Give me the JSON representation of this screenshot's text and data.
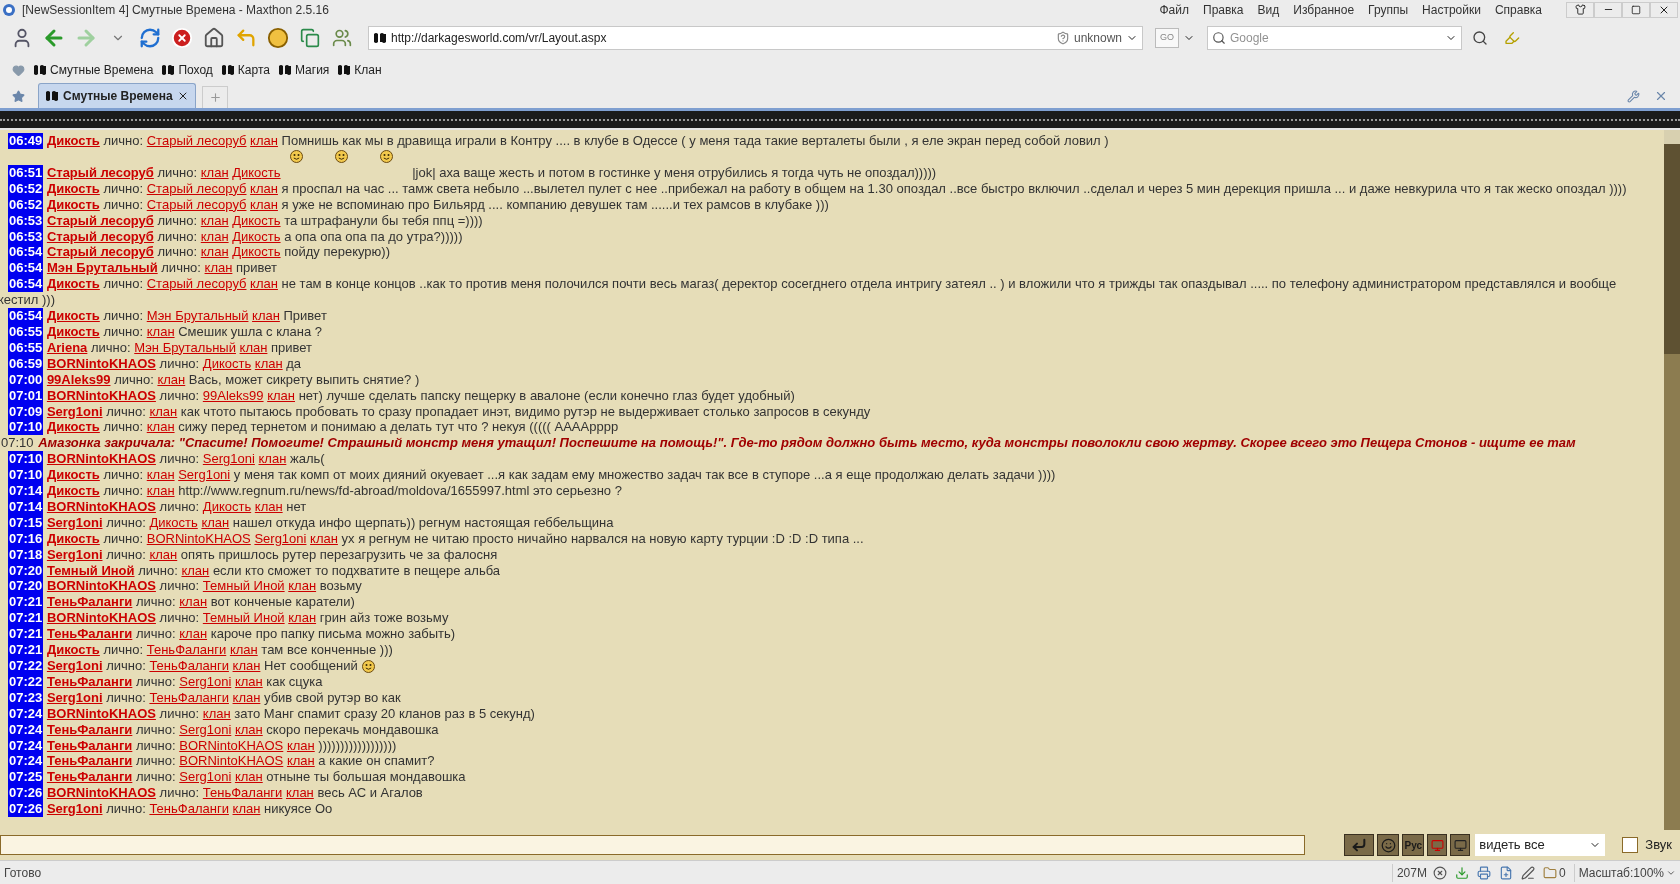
{
  "window": {
    "title": "[NewSessionItem 4] Смутные Времена - Maxthon 2.5.16"
  },
  "menu": [
    "Файл",
    "Правка",
    "Вид",
    "Избранное",
    "Группы",
    "Настройки",
    "Справка"
  ],
  "address": {
    "value": "http://darkagesworld.com/vr/Layout.aspx",
    "security": "unknown",
    "go": "GO"
  },
  "search": {
    "placeholder": "Google"
  },
  "bookmarks": [
    "Смутные Времена",
    "Поход",
    "Карта",
    "Магия",
    "Клан"
  ],
  "tabs": [
    {
      "label": "Смутные Времена",
      "selected": true
    }
  ],
  "messages": [
    {
      "kind": "private",
      "time": "06:49",
      "sender": "Дикость",
      "label": "лично:",
      "to": [
        "Старый лесоруб",
        "клан"
      ],
      "text": "Помнишь как мы в дравища играли в Контру .... в клубе в Одессе ( у меня тада такие верталеты были , я еле экран перед собой ловил )"
    },
    {
      "kind": "emotes"
    },
    {
      "kind": "private",
      "time": "06:51",
      "sender": "Старый лесоруб",
      "label": "лично:",
      "to": [
        "клан",
        "Дикость"
      ],
      "text": "|jok| аха ваще жесть и потом в гостинке у меня отрубились я тогда чуть не опоздал)))))",
      "indent": true
    },
    {
      "kind": "private",
      "time": "06:52",
      "sender": "Дикость",
      "label": "лично:",
      "to": [
        "Старый лесоруб",
        "клан"
      ],
      "text": "я проспал на час ... тамж света небыло ...вылетел пулет с нее ..прибежал на работу в общем на 1.30 опоздал ..все быстро включил ..сделал и через 5 мин дерекция пришла ... и даже невкурила что я так жеско опоздал ))))"
    },
    {
      "kind": "private",
      "time": "06:52",
      "sender": "Дикость",
      "label": "лично:",
      "to": [
        "Старый лесоруб",
        "клан"
      ],
      "text": "я уже не вспоминаю про Бильярд .... компанию девушек там ......и тех рамсов в клубаке )))"
    },
    {
      "kind": "private",
      "time": "06:53",
      "sender": "Старый лесоруб",
      "label": "лично:",
      "to": [
        "клан",
        "Дикость"
      ],
      "text": "та штрафанули бы тебя ппц =))))"
    },
    {
      "kind": "private",
      "time": "06:53",
      "sender": "Старый лесоруб",
      "label": "лично:",
      "to": [
        "клан",
        "Дикость"
      ],
      "text": "а опа опа опа па до утра?)))))"
    },
    {
      "kind": "private",
      "time": "06:54",
      "sender": "Старый лесоруб",
      "label": "лично:",
      "to": [
        "клан",
        "Дикость"
      ],
      "text": "пойду перекурю))"
    },
    {
      "kind": "private",
      "time": "06:54",
      "sender": "Мэн Брутальный",
      "label": "лично:",
      "to": [
        "клан"
      ],
      "text": "привет"
    },
    {
      "kind": "private",
      "time": "06:54",
      "sender": "Дикость",
      "label": "лично:",
      "to": [
        "Старый лесоруб",
        "клан"
      ],
      "text": "не там в конце концов ..как то против меня полочился почти весь магаз( деректор сосегднего отдела интригу затеял .. ) и вложили что я трижды так опаздывал ..... по телефону администратором представлялся и вообще",
      "wrap": "кестил )))"
    },
    {
      "kind": "private",
      "time": "06:54",
      "sender": "Дикость",
      "label": "лично:",
      "to": [
        "Мэн Брутальный",
        "клан"
      ],
      "text": "Привет"
    },
    {
      "kind": "private",
      "time": "06:55",
      "sender": "Дикость",
      "label": "лично:",
      "to": [
        "клан"
      ],
      "text": "Смешик ушла с клана ?"
    },
    {
      "kind": "private",
      "time": "06:55",
      "sender": "Ariena",
      "label": "лично:",
      "to": [
        "Мэн Брутальный",
        "клан"
      ],
      "text": "привет"
    },
    {
      "kind": "private",
      "time": "06:59",
      "sender": "BORNintoKHAOS",
      "label": "лично:",
      "to": [
        "Дикость",
        "клан"
      ],
      "text": "да"
    },
    {
      "kind": "private",
      "time": "07:00",
      "sender": "99Aleks99",
      "label": "лично:",
      "to": [
        "клан"
      ],
      "text": "Вась, может сикрету выпить снятие? )"
    },
    {
      "kind": "private",
      "time": "07:01",
      "sender": "BORNintoKHAOS",
      "label": "лично:",
      "to": [
        "99Aleks99",
        "клан"
      ],
      "text": "нет) лучше сделать папску пещерку в авалоне (если конечно глаз будет удобный)"
    },
    {
      "kind": "private",
      "time": "07:09",
      "sender": "Serg1oni",
      "label": "лично:",
      "to": [
        "клан"
      ],
      "text": "как чтото пытаюсь пробовать то сразу пропадает инэт, видимо рутэр не выдерживает столько запросов в секунду"
    },
    {
      "kind": "private",
      "time": "07:10",
      "sender": "Дикость",
      "label": "лично:",
      "to": [
        "клан"
      ],
      "text": "сижу перед тернетом и понимаю а делать тут что ? некуя ((((( ААААрррр"
    },
    {
      "kind": "system",
      "time": "07:10",
      "text": "Амазонка закричала: \"Спасите! Помогите! Страшный монстр меня утащил! Поспешите на помощь!\". Где-то рядом должно быть место, куда монстры поволокли свою жертву. Скорее всего это Пещера Стонов - ищите ее там"
    },
    {
      "kind": "private",
      "time": "07:10",
      "sender": "BORNintoKHAOS",
      "label": "лично:",
      "to": [
        "Serg1oni",
        "клан"
      ],
      "text": "жаль("
    },
    {
      "kind": "private",
      "time": "07:10",
      "sender": "Дикость",
      "label": "лично:",
      "to": [
        "клан",
        "Serg1oni"
      ],
      "text": "у меня так комп от моих дияний окуевает ...я как задам ему множество задач так все в ступоре ...а я еще продолжаю делать задачи ))))"
    },
    {
      "kind": "private",
      "time": "07:14",
      "sender": "Дикость",
      "label": "лично:",
      "to": [
        "клан"
      ],
      "text": "http://www.regnum.ru/news/fd-abroad/moldova/1655997.html это серьезно ?"
    },
    {
      "kind": "private",
      "time": "07:14",
      "sender": "BORNintoKHAOS",
      "label": "лично:",
      "to": [
        "Дикость",
        "клан"
      ],
      "text": "нет"
    },
    {
      "kind": "private",
      "time": "07:15",
      "sender": "Serg1oni",
      "label": "лично:",
      "to": [
        "Дикость",
        "клан"
      ],
      "text": "нашел откуда инфо щерпать)) регнум настоящая геббельщина"
    },
    {
      "kind": "private",
      "time": "07:16",
      "sender": "Дикость",
      "label": "лично:",
      "to": [
        "BORNintoKHAOS",
        "Serg1oni",
        "клан"
      ],
      "text": "ух я регнум не читаю просто ничайно нарвался на новую карту турции :D :D :D типа ..."
    },
    {
      "kind": "private",
      "time": "07:18",
      "sender": "Serg1oni",
      "label": "лично:",
      "to": [
        "клан"
      ],
      "text": "опять пришлось рутер перезагрузить че за фалосня"
    },
    {
      "kind": "private",
      "time": "07:20",
      "sender": "Темный Иной",
      "label": "лично:",
      "to": [
        "клан"
      ],
      "text": "если кто сможет то подхватите в пещере альба"
    },
    {
      "kind": "private",
      "time": "07:20",
      "sender": "BORNintoKHAOS",
      "label": "лично:",
      "to": [
        "Темный Иной",
        "клан"
      ],
      "text": "возьму"
    },
    {
      "kind": "private",
      "time": "07:21",
      "sender": "ТеньФаланги",
      "label": "лично:",
      "to": [
        "клан"
      ],
      "text": "вот конченые каратели)"
    },
    {
      "kind": "private",
      "time": "07:21",
      "sender": "BORNintoKHAOS",
      "label": "лично:",
      "to": [
        "Темный Иной",
        "клан"
      ],
      "text": "грин айз тоже возьму"
    },
    {
      "kind": "private",
      "time": "07:21",
      "sender": "ТеньФаланги",
      "label": "лично:",
      "to": [
        "клан"
      ],
      "text": "кароче про папку письма можно забыть)"
    },
    {
      "kind": "private",
      "time": "07:21",
      "sender": "Дикость",
      "label": "лично:",
      "to": [
        "ТеньФаланги",
        "клан"
      ],
      "text": "там все конченные )))"
    },
    {
      "kind": "private",
      "time": "07:22",
      "sender": "Serg1oni",
      "label": "лично:",
      "to": [
        "ТеньФаланги",
        "клан"
      ],
      "text": "Нет сообщений",
      "emote": true
    },
    {
      "kind": "private",
      "time": "07:22",
      "sender": "ТеньФаланги",
      "label": "лично:",
      "to": [
        "Serg1oni",
        "клан"
      ],
      "text": "как сцука"
    },
    {
      "kind": "private",
      "time": "07:23",
      "sender": "Serg1oni",
      "label": "лично:",
      "to": [
        "ТеньФаланги",
        "клан"
      ],
      "text": "убив свой рутэр во как"
    },
    {
      "kind": "private",
      "time": "07:24",
      "sender": "BORNintoKHAOS",
      "label": "лично:",
      "to": [
        "клан"
      ],
      "text": "зато Манг спамит сразу 20 кланов раз в 5 секунд)"
    },
    {
      "kind": "private",
      "time": "07:24",
      "sender": "ТеньФаланги",
      "label": "лично:",
      "to": [
        "Serg1oni",
        "клан"
      ],
      "text": "скоро перекачь мондавошка"
    },
    {
      "kind": "private",
      "time": "07:24",
      "sender": "ТеньФаланги",
      "label": "лично:",
      "to": [
        "BORNintoKHAOS",
        "клан"
      ],
      "text": "))))))))))))))))))"
    },
    {
      "kind": "private",
      "time": "07:24",
      "sender": "ТеньФаланги",
      "label": "лично:",
      "to": [
        "BORNintoKHAOS",
        "клан"
      ],
      "text": "а какие он спамит?"
    },
    {
      "kind": "private",
      "time": "07:25",
      "sender": "ТеньФаланги",
      "label": "лично:",
      "to": [
        "Serg1oni",
        "клан"
      ],
      "text": "отныне ты большая мондавошка"
    },
    {
      "kind": "private",
      "time": "07:26",
      "sender": "BORNintoKHAOS",
      "label": "лично:",
      "to": [
        "ТеньФаланги",
        "клан"
      ],
      "text": "весь АС и Агалов"
    },
    {
      "kind": "private",
      "time": "07:26",
      "sender": "Serg1oni",
      "label": "лично:",
      "to": [
        "ТеньФаланги",
        "клан"
      ],
      "text": "никуясе Оо"
    }
  ],
  "chat_controls": {
    "layout_label": "Рус",
    "filter": "видеть все",
    "sound": {
      "label": "Звук",
      "checked": false
    }
  },
  "status_bar": {
    "text": "Готово",
    "memory": "207M",
    "blocked": "0",
    "zoom": "Масштаб:100%"
  }
}
